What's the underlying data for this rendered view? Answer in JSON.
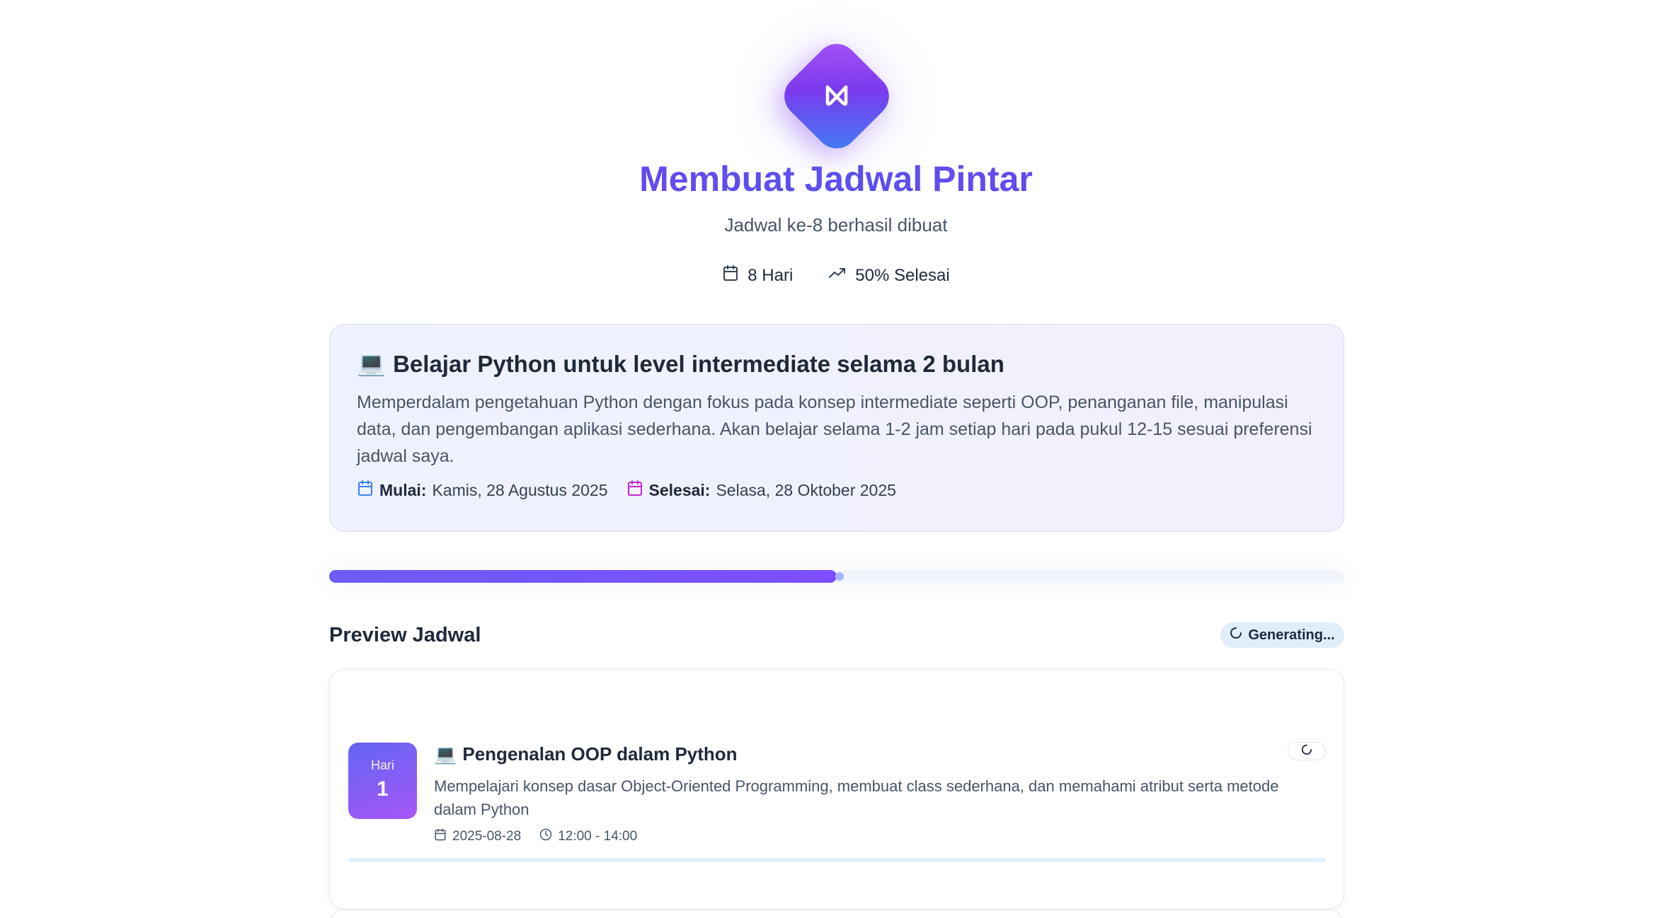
{
  "header": {
    "title": "Membuat Jadwal Pintar",
    "subtitle": "Jadwal ke-8 berhasil dibuat",
    "logo_icon": "wave-w-icon"
  },
  "stats": {
    "days": "8 Hari",
    "completion": "50% Selesai"
  },
  "goal": {
    "icon": "💻",
    "title": "Belajar Python untuk level intermediate selama 2 bulan",
    "description": "Memperdalam pengetahuan Python dengan fokus pada konsep intermediate seperti OOP, penanganan file, manipulasi data, dan pengembangan aplikasi sederhana. Akan belajar selama 1-2 jam setiap hari pada pukul 12-15 sesuai preferensi jadwal saya.",
    "start_label": "Mulai:",
    "start_value": "Kamis, 28 Agustus 2025",
    "end_label": "Selesai:",
    "end_value": "Selasa, 28 Oktober 2025"
  },
  "progress": {
    "fraction": 0.5
  },
  "preview": {
    "heading": "Preview Jadwal",
    "status": "Generating..."
  },
  "schedule": [
    {
      "day_label": "Hari",
      "day_number": "1",
      "icon": "💻",
      "title": "Pengenalan OOP dalam Python",
      "description": "Mempelajari konsep dasar Object-Oriented Programming, membuat class sederhana, dan memahami atribut serta metode dalam Python",
      "date": "2025-08-28",
      "time": "12:00 - 14:00"
    }
  ],
  "colors": {
    "accent": "#6d3df0",
    "badge_start": "#6366f1",
    "badge_end": "#a855f7",
    "goal_start_icon": "#3b82f6",
    "goal_end_icon": "#c026d3"
  }
}
